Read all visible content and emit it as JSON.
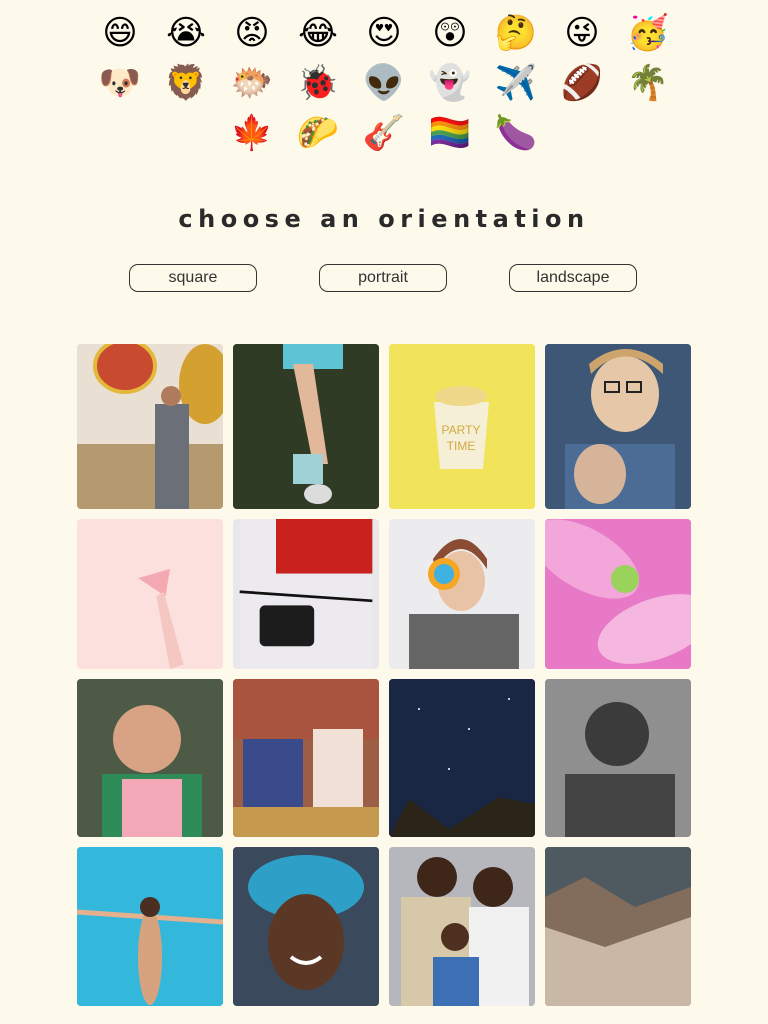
{
  "emoji_rows": [
    [
      {
        "char": "😄",
        "icon": "grinning-face-icon"
      },
      {
        "char": "😭",
        "icon": "loudly-crying-face-icon"
      },
      {
        "char": "😡",
        "icon": "angry-face-icon"
      },
      {
        "char": "😂",
        "icon": "tears-of-joy-face-icon"
      },
      {
        "char": "😍",
        "icon": "heart-eyes-face-icon"
      },
      {
        "char": "😲",
        "icon": "astonished-face-icon"
      },
      {
        "char": "🤔",
        "icon": "thinking-face-icon"
      },
      {
        "char": "😜",
        "icon": "winking-tongue-face-icon"
      },
      {
        "char": "🥳",
        "icon": "partying-face-icon"
      }
    ],
    [
      {
        "char": "🐶",
        "icon": "dog-face-icon"
      },
      {
        "char": "🦁",
        "icon": "lion-face-icon"
      },
      {
        "char": "🐡",
        "icon": "blowfish-icon"
      },
      {
        "char": "🐞",
        "icon": "ladybug-icon"
      },
      {
        "char": "👽",
        "icon": "alien-icon"
      },
      {
        "char": "👻",
        "icon": "ghost-icon"
      },
      {
        "char": "✈️",
        "icon": "airplane-icon"
      },
      {
        "char": "🏈",
        "icon": "american-football-icon"
      },
      {
        "char": "🌴",
        "icon": "palm-tree-icon"
      }
    ],
    [
      {
        "char": "🍁",
        "icon": "maple-leaf-icon"
      },
      {
        "char": "🌮",
        "icon": "taco-icon"
      },
      {
        "char": "🎸",
        "icon": "guitar-icon"
      },
      {
        "char": "🏳️‍🌈",
        "icon": "rainbow-flag-icon"
      },
      {
        "char": "🍆",
        "icon": "eggplant-icon"
      }
    ]
  ],
  "heading": "choose an orientation",
  "orientation_buttons": {
    "square": "square",
    "portrait": "portrait",
    "landscape": "landscape"
  },
  "photos": [
    {
      "name": "photo-hot-air-balloons-girl",
      "bg": "#d8c9a8"
    },
    {
      "name": "photo-legs-sneakers",
      "bg": "#3c4a2e"
    },
    {
      "name": "photo-party-time-cup",
      "bg": "#f1e35a"
    },
    {
      "name": "photo-man-glasses",
      "bg": "#5c7496"
    },
    {
      "name": "photo-pink-drink",
      "bg": "#fce0de"
    },
    {
      "name": "photo-ysl-bag-chanel",
      "bg": "#e8e8ec"
    },
    {
      "name": "photo-woman-lollipop",
      "bg": "#e4e4e6"
    },
    {
      "name": "photo-pink-flower",
      "bg": "#e98bc9"
    },
    {
      "name": "photo-child-smiling",
      "bg": "#5b6b53"
    },
    {
      "name": "photo-kids-reading",
      "bg": "#8a5d45"
    },
    {
      "name": "photo-night-sky",
      "bg": "#1f2c47"
    },
    {
      "name": "photo-elder-bw",
      "bg": "#8b8b8b"
    },
    {
      "name": "photo-woman-pool",
      "bg": "#32b6d8"
    },
    {
      "name": "photo-man-turban",
      "bg": "#3f7798"
    },
    {
      "name": "photo-family-portrait",
      "bg": "#b7b9bf"
    },
    {
      "name": "photo-rocky-hiker",
      "bg": "#8f7b6a"
    }
  ]
}
